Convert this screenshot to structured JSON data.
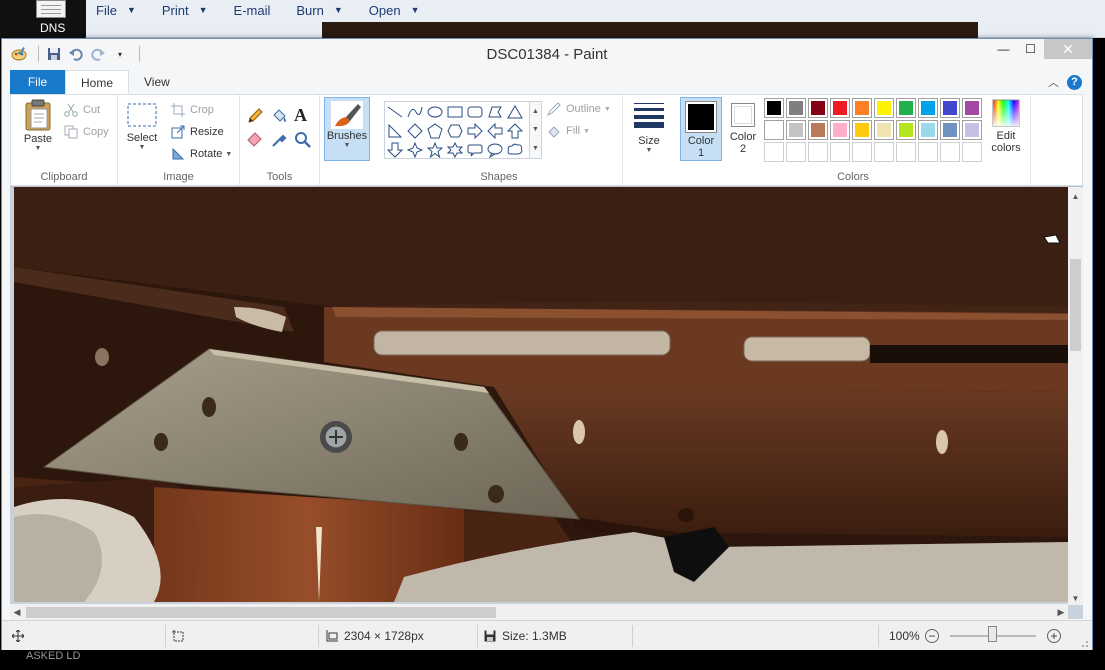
{
  "background_app": {
    "dns_label": "DNS",
    "menu": [
      {
        "label": "File"
      },
      {
        "label": "Print"
      },
      {
        "label": "E-mail"
      },
      {
        "label": "Burn"
      },
      {
        "label": "Open"
      }
    ],
    "footer_text": "ASKED LD"
  },
  "window": {
    "title": "DSC01384 - Paint",
    "controls": {
      "minimize": "—",
      "maximize": "☐",
      "close": "✕"
    }
  },
  "tabs": {
    "file": "File",
    "home": "Home",
    "view": "View"
  },
  "clipboard": {
    "paste": "Paste",
    "cut": "Cut",
    "copy": "Copy",
    "label": "Clipboard"
  },
  "image": {
    "select": "Select",
    "crop": "Crop",
    "resize": "Resize",
    "rotate": "Rotate",
    "label": "Image"
  },
  "tools": {
    "label": "Tools"
  },
  "brushes": {
    "label": "Brushes"
  },
  "shapes": {
    "outline": "Outline",
    "fill": "Fill",
    "label": "Shapes"
  },
  "size": {
    "label": "Size"
  },
  "colors": {
    "color1_label": "Color",
    "color1_num": "1",
    "color2_label": "Color",
    "color2_num": "2",
    "edit_line1": "Edit",
    "edit_line2": "colors",
    "label": "Colors",
    "color1_value": "#000000",
    "color2_value": "#ffffff",
    "palette_row1": [
      "#000000",
      "#7f7f7f",
      "#880015",
      "#ed1c24",
      "#ff7f27",
      "#fff200",
      "#22b14c",
      "#00a2e8",
      "#3f48cc",
      "#a349a4"
    ],
    "palette_row2": [
      "#ffffff",
      "#c3c3c3",
      "#b97a57",
      "#ffaec9",
      "#ffc90e",
      "#efe4b0",
      "#b5e61d",
      "#99d9ea",
      "#7092be",
      "#c8bfe7"
    ],
    "palette_row3": [
      "",
      "",
      "",
      "",
      "",
      "",
      "",
      "",
      "",
      ""
    ]
  },
  "status": {
    "dimensions": "2304 × 1728px",
    "size": "Size: 1.3MB",
    "zoom": "100%"
  }
}
